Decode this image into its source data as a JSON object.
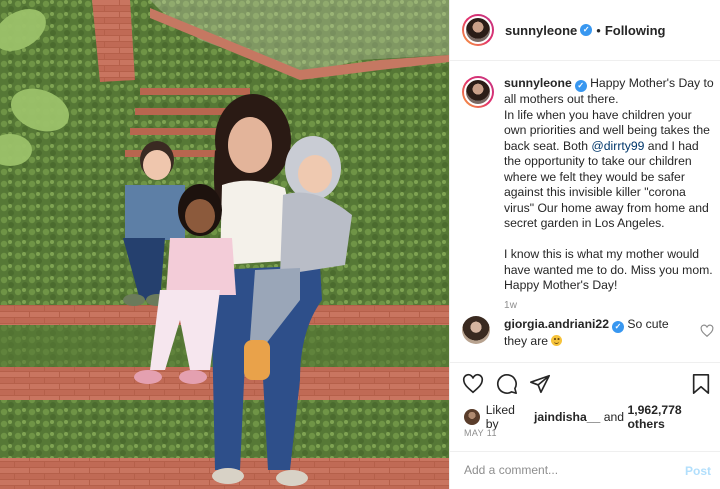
{
  "post": {
    "username": "sunnyleone",
    "verified_badge": "✓",
    "separator": "•",
    "follow_status": "Following",
    "caption": "Happy Mother's Day to all mothers out there.\nIn life when you have children your own priorities and well being takes the back seat. Both ",
    "caption_mention": "@dirrty99",
    "caption_rest": " and I had the opportunity to take our children where we felt they would be safer against this invisible killer \"corona virus\" Our home away from home and secret garden in Los Angeles.\n\nI know this is what my mother would have wanted me to do. Miss you mom. Happy Mother's Day!",
    "time_ago": "1w"
  },
  "comment": {
    "username": "giorgia.andriani22",
    "text": "So cute they are",
    "emoji": "smiling-face-emoji"
  },
  "likes": {
    "prefix": "Liked by",
    "user": "jaindisha__",
    "and": "and",
    "count_text": "1,962,778 others"
  },
  "date": "MAY 11",
  "add_comment": {
    "placeholder": "Add a comment...",
    "post_label": "Post"
  },
  "icons": {
    "like": "heart-icon",
    "comment": "comment-icon",
    "share": "share-icon",
    "save": "bookmark-icon",
    "comment_like": "heart-icon"
  },
  "colors": {
    "verified": "#3897f0",
    "mention": "#00376b",
    "post_button": "#b2dffc",
    "muted": "#8e8e8e"
  }
}
